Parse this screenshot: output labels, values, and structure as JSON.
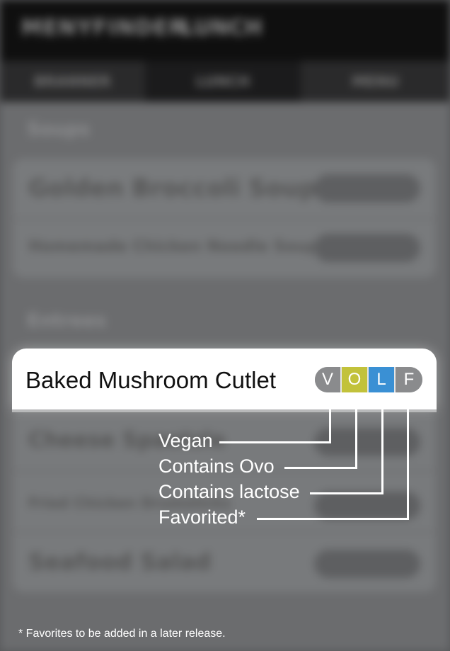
{
  "background": {
    "title": "MENYFINDER",
    "title_sep": "LUNCH",
    "tabs": [
      "BRANNER",
      "LUNCH",
      "MENU"
    ],
    "sections": [
      {
        "heading": "Soups",
        "rows": [
          {
            "label": "Golden Broccoli Soup"
          },
          {
            "label": "Homemade Chicken Noodle Soup"
          }
        ]
      },
      {
        "heading": "Entrees",
        "rows": [
          {
            "label": "Baked Mushroom Cutlet"
          },
          {
            "label": "Cheese Spaetzle"
          },
          {
            "label": "Fried Chicken Drumsticks"
          },
          {
            "label": "Seafood Salad"
          }
        ]
      }
    ]
  },
  "highlight": {
    "item_name": "Baked Mushroom Cutlet",
    "badges": [
      {
        "letter": "V",
        "color": "#8a8b8d"
      },
      {
        "letter": "O",
        "color": "#c2c23b"
      },
      {
        "letter": "L",
        "color": "#3a90d4"
      },
      {
        "letter": "F",
        "color": "#8a8b8d"
      }
    ]
  },
  "legend": {
    "vegan": "Vegan",
    "ovo": "Contains Ovo",
    "lactose": "Contains lactose",
    "favorited": "Favorited*"
  },
  "footnote": "* Favorites to be added in a later release.",
  "colors": {
    "highlight_bg": "#ffffff",
    "legend_text": "#ffffff",
    "dim_overlay": "#57585a"
  }
}
